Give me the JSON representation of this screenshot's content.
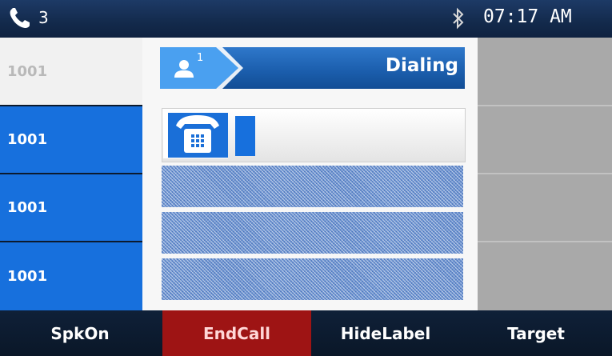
{
  "status_bar": {
    "line_count": "3",
    "time": "07:17 AM",
    "icons": [
      "phone-icon",
      "bluetooth-icon"
    ]
  },
  "line_keys": [
    {
      "label": "1001",
      "state": "active"
    },
    {
      "label": "1001",
      "state": "idle"
    },
    {
      "label": "1001",
      "state": "idle"
    },
    {
      "label": "1001",
      "state": "idle"
    }
  ],
  "call_panel": {
    "contact_index": "1",
    "status": "Dialing",
    "dialed_number": "",
    "icons": [
      "contact-icon",
      "desk-phone-icon"
    ]
  },
  "softkeys": [
    {
      "label": "SpkOn"
    },
    {
      "label": "EndCall"
    },
    {
      "label": "HideLabel"
    },
    {
      "label": "Target"
    }
  ],
  "colors": {
    "line_key_blue": "#1770dd",
    "endcall_red": "#9e1414",
    "status_bar": "#132a4c"
  }
}
